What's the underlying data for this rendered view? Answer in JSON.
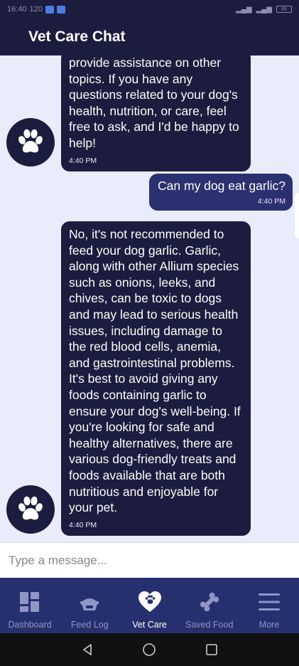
{
  "status": {
    "time": "16:40",
    "extra": "120",
    "battery": "89"
  },
  "header": {
    "title": "Vet Care Chat"
  },
  "messages": [
    {
      "from": "bot",
      "text": "provide assistance on other topics. If you have any questions related to your dog's health, nutrition, or care, feel free to ask, and I'd be happy to help!",
      "time": "4:40 PM"
    },
    {
      "from": "user",
      "text": "Can my dog eat garlic?",
      "time": "4:40 PM"
    },
    {
      "from": "bot",
      "text": "No, it's not recommended to feed your dog garlic. Garlic, along with other Allium species such as onions, leeks, and chives, can be toxic to dogs and may lead to serious health issues, including damage to the red blood cells, anemia, and gastrointestinal problems. It's best to avoid giving any foods containing garlic to ensure your dog's well-being. If you're looking for safe and healthy alternatives, there are various dog-friendly treats and foods available that are both nutritious and enjoyable for your pet.",
      "time": "4:40 PM"
    }
  ],
  "input": {
    "placeholder": "Type a message..."
  },
  "nav": {
    "items": [
      {
        "label": "Dashboard",
        "icon": "dashboard-icon"
      },
      {
        "label": "Feed Log",
        "icon": "feed-bowl-icon"
      },
      {
        "label": "Vet Care",
        "icon": "heart-paw-icon",
        "active": true
      },
      {
        "label": "Saved Food",
        "icon": "bone-icon"
      },
      {
        "label": "More",
        "icon": "menu-icon"
      }
    ]
  },
  "colors": {
    "primary": "#1b1c3e",
    "nav_bg": "#26306f",
    "user_bubble": "#2a3070",
    "chat_bg": "#e8ecfb"
  }
}
